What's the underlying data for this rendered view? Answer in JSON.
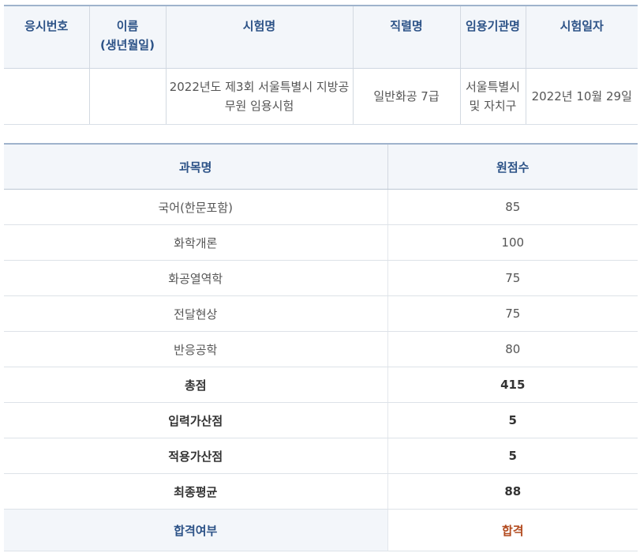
{
  "exam_info": {
    "headers": [
      "응시번호",
      "이름\n(생년월일)",
      "시험명",
      "직렬명",
      "임용기관명",
      "시험일자"
    ],
    "row": {
      "applicant_number": "",
      "name_birth": "",
      "exam_name": "2022년도 제3회 서울특별시 지방공무원 임용시험",
      "series": "일반화공 7급",
      "agency": "서울특별시 및 자치구",
      "exam_date": "2022년 10월 29일"
    }
  },
  "scores": {
    "headers": [
      "과목명",
      "원점수"
    ],
    "subjects": [
      {
        "name": "국어(한문포함)",
        "score": "85"
      },
      {
        "name": "화학개론",
        "score": "100"
      },
      {
        "name": "화공열역학",
        "score": "75"
      },
      {
        "name": "전달현상",
        "score": "75"
      },
      {
        "name": "반응공학",
        "score": "80"
      }
    ],
    "summary": [
      {
        "name": "총점",
        "score": "415"
      },
      {
        "name": "입력가산점",
        "score": "5"
      },
      {
        "name": "적용가산점",
        "score": "5"
      },
      {
        "name": "최종평균",
        "score": "88"
      }
    ],
    "result": {
      "label": "합격여부",
      "value": "합격"
    }
  },
  "colors": {
    "header_text": "#2c5287",
    "header_bg": "#f3f6fa",
    "pass_text": "#b24a1e"
  }
}
